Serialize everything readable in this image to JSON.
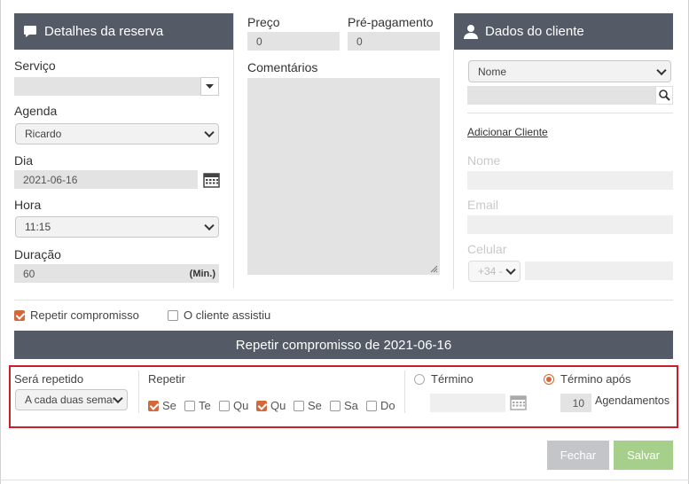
{
  "booking": {
    "header": "Detalhes da reserva",
    "service_label": "Serviço",
    "service_value": "",
    "agenda_label": "Agenda",
    "agenda_value": "Ricardo",
    "day_label": "Dia",
    "day_value": "2021-06-16",
    "time_label": "Hora",
    "time_value": "11:15",
    "duration_label": "Duração",
    "duration_value": "60",
    "duration_unit": "(Min.)"
  },
  "pricing": {
    "price_label": "Preço",
    "price_value": "0",
    "prepay_label": "Pré-pagamento",
    "prepay_value": "0",
    "comments_label": "Comentários"
  },
  "client": {
    "header": "Dados do cliente",
    "search_by": "Nome",
    "add_link": "Adicionar Cliente",
    "name_label": "Nome",
    "email_label": "Email",
    "phone_label": "Celular",
    "country_code": "+34 -"
  },
  "options": {
    "repeat_label": "Repetir compromisso",
    "repeat_checked": true,
    "attended_label": "O cliente assistiu",
    "attended_checked": false
  },
  "repeat_panel": {
    "title": "Repetir compromisso de 2021-06-16",
    "frequency_label": "Será repetido",
    "frequency_value": "A cada duas semanas",
    "repeat_label": "Repetir",
    "days": [
      {
        "label": "Se",
        "checked": true
      },
      {
        "label": "Te",
        "checked": false
      },
      {
        "label": "Qu",
        "checked": false
      },
      {
        "label": "Qu",
        "checked": true
      },
      {
        "label": "Se",
        "checked": false
      },
      {
        "label": "Sa",
        "checked": false
      },
      {
        "label": "Do",
        "checked": false
      }
    ],
    "end_label": "Término",
    "end_selected": false,
    "end_date_value": "",
    "end_after_label": "Término após",
    "end_after_selected": true,
    "end_after_count": "10",
    "end_after_unit": "Agendamentos"
  },
  "footer": {
    "close_label": "Fechar",
    "save_label": "Salvar"
  },
  "colors": {
    "header_bg": "#545a66",
    "accent": "#d2693a",
    "save_bg": "#a5cf8a",
    "close_bg": "#c3c5c9",
    "highlight_border": "#c8202a"
  }
}
